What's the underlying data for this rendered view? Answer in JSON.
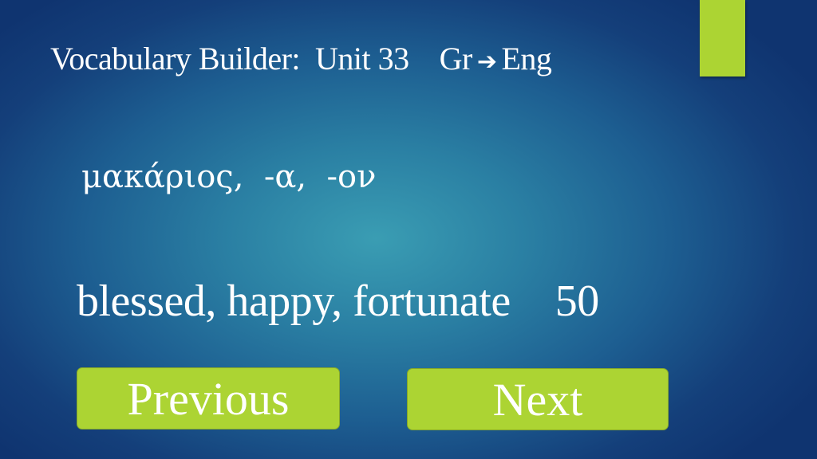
{
  "header": {
    "title": "Vocabulary Builder:  Unit 33    Gr",
    "arrow_icon": "right-arrow-icon",
    "arrow_glyph": "➔",
    "direction_target": "Eng"
  },
  "card": {
    "greek_term": "μακάριος,  -α,  -ον",
    "english_meaning": "blessed, happy, fortunate",
    "frequency": "50"
  },
  "navigation": {
    "previous_label": "Previous",
    "next_label": "Next"
  },
  "colors": {
    "accent": "#acd433",
    "background_center": "#3a9db3",
    "background_edge": "#0f3470"
  }
}
